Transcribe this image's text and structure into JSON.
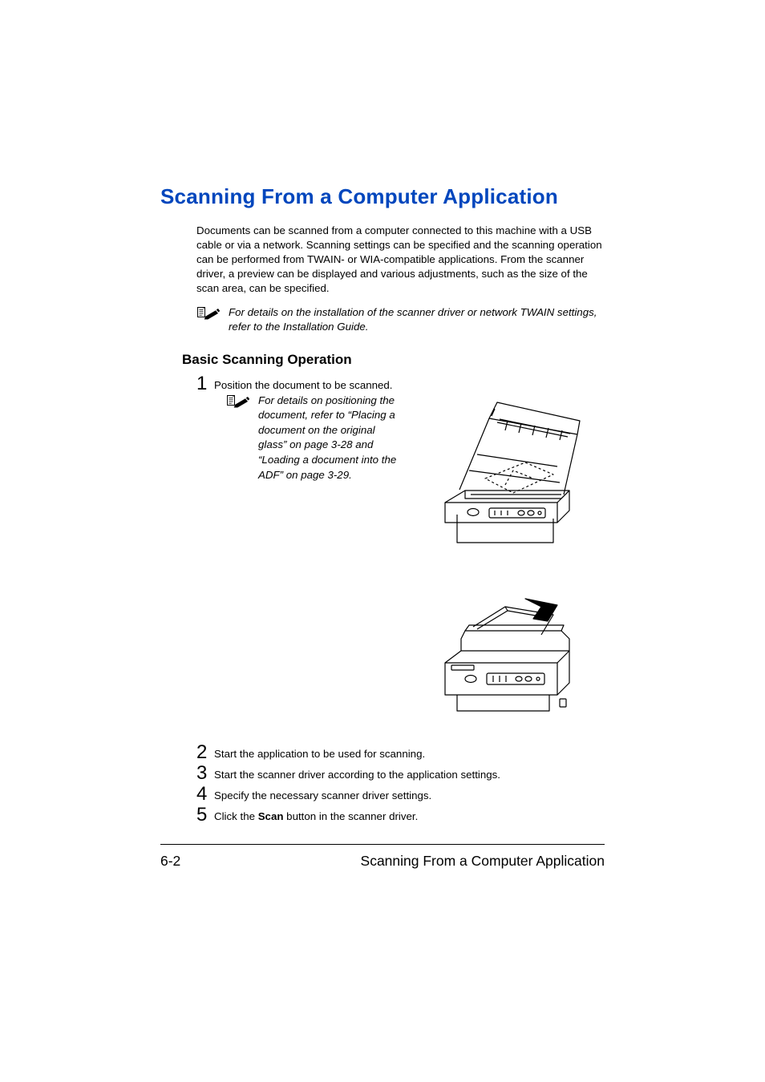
{
  "heading": "Scanning From a Computer Application",
  "intro": "Documents can be scanned from a computer connected to this machine with a USB cable or via a network. Scanning settings can be specified and the scanning operation can be performed from TWAIN- or WIA-compatible applications. From the scanner driver, a preview can be displayed and various adjustments, such as the size of the scan area, can be specified.",
  "top_note": "For details on the installation of the scanner driver or network TWAIN settings, refer to the Installation Guide.",
  "sub_heading": "Basic Scanning Operation",
  "steps": {
    "s1_num": "1",
    "s1_text": "Position the document to be scanned.",
    "s1_note": "For details on positioning the document, refer to “Placing a document on the original glass” on page 3-28 and “Loading a document into the ADF” on page 3-29.",
    "s2_num": "2",
    "s2_text": "Start the application to be used for scanning.",
    "s3_num": "3",
    "s3_text": "Start the scanner driver according to the application settings.",
    "s4_num": "4",
    "s4_text": "Specify the necessary scanner driver settings.",
    "s5_num": "5",
    "s5_text_pre": "Click the ",
    "s5_bold": "Scan",
    "s5_text_post": " button in the scanner driver."
  },
  "footer": {
    "page_num": "6-2",
    "title": "Scanning From a Computer Application"
  }
}
